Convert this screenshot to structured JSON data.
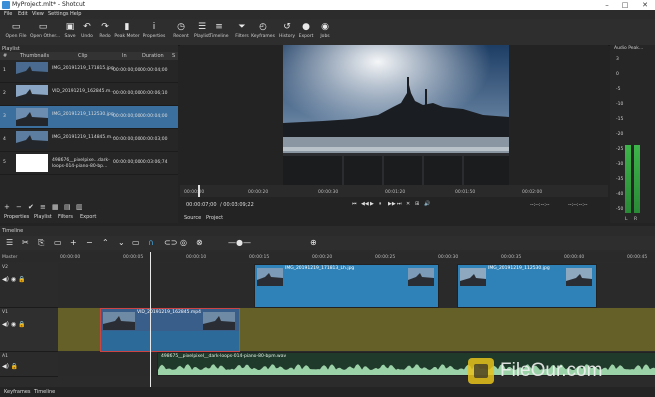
{
  "window": {
    "title": "MyProject.mlt* - Shotcut",
    "controls": [
      "–",
      "□",
      "✕"
    ]
  },
  "menu": [
    "File",
    "Edit",
    "View",
    "Settings",
    "Help"
  ],
  "toolbar": [
    {
      "icon": "folder-open-icon",
      "glyph": "▭",
      "label": "Open File"
    },
    {
      "icon": "open-other-icon",
      "glyph": "▭",
      "label": "Open Other..."
    },
    {
      "icon": "save-icon",
      "glyph": "▣",
      "label": "Save"
    },
    {
      "icon": "undo-icon",
      "glyph": "↶",
      "label": "Undo"
    },
    {
      "icon": "redo-icon",
      "glyph": "↷",
      "label": "Redo"
    },
    {
      "icon": "peak-meter-icon",
      "glyph": "▮",
      "label": "Peak Meter"
    },
    {
      "icon": "properties-icon",
      "glyph": "ⅰ",
      "label": "Properties"
    },
    {
      "icon": "recent-icon",
      "glyph": "◷",
      "label": "Recent"
    },
    {
      "icon": "playlist-icon",
      "glyph": "☰",
      "label": "Playlist"
    },
    {
      "icon": "timeline-icon",
      "glyph": "≡",
      "label": "Timeline"
    },
    {
      "icon": "filters-icon",
      "glyph": "⏷",
      "label": "Filters"
    },
    {
      "icon": "keyframes-icon",
      "glyph": "◴",
      "label": "Keyframes"
    },
    {
      "icon": "history-icon",
      "glyph": "↺",
      "label": "History"
    },
    {
      "icon": "export-icon",
      "glyph": "●",
      "label": "Export"
    },
    {
      "icon": "jobs-icon",
      "glyph": "◉",
      "label": "Jobs"
    }
  ],
  "playlist": {
    "title": "Playlist",
    "columns": [
      "#",
      "Thumbnails",
      "Clip",
      "In",
      "Duration",
      "S"
    ],
    "rows": [
      {
        "num": "1",
        "clip": "IMG_20191219_171815.jpg",
        "in": "00:00:00;00",
        "duration": "00:00:04;00",
        "selected": false
      },
      {
        "num": "2",
        "clip": "VID_20191219_162845.m...",
        "in": "00:00:00;00",
        "duration": "00:00:06;10",
        "selected": false
      },
      {
        "num": "3",
        "clip": "IMG_20191219_112530.jpg",
        "in": "00:00:00;00",
        "duration": "00:00:04;00",
        "selected": true
      },
      {
        "num": "4",
        "clip": "IMG_20191219_114845.m...",
        "in": "00:00:00;00",
        "duration": "00:00:03;00",
        "selected": false
      },
      {
        "num": "5",
        "clip": "498676__pixelpixe...dark-loops-014-piano-80-bp...",
        "in": "00:00:00;00",
        "duration": "00:03:06;74",
        "selected": false
      }
    ],
    "tools": [
      "+",
      "−",
      "✔",
      "≡",
      "▦",
      "▤",
      "▥"
    ],
    "tabs": [
      "Properties",
      "Playlist",
      "Filters",
      "Export"
    ]
  },
  "viewer": {
    "ruler_ticks": [
      "00:00:00",
      "00:00:20",
      "00:00:30",
      "00:01:20",
      "00:01:50",
      "00:02:00"
    ],
    "timecode_current": "00:00:07;00",
    "timecode_total": "/ 00:03:09;22",
    "transport": [
      "⏮",
      "◀◀",
      "▶",
      "⏸",
      "▶▶",
      "⏭",
      "✕",
      "⊞",
      "🔊"
    ],
    "in_out": "--:--:--:--",
    "tabs": [
      "Source",
      "Project"
    ]
  },
  "meter": {
    "title": "Audio Peak...",
    "scale": [
      "3",
      "0",
      "-5",
      "-10",
      "-15",
      "-20",
      "-25",
      "-30",
      "-35",
      "-40",
      "-50"
    ],
    "channels": [
      "L",
      "R"
    ],
    "level_left": 0.45,
    "level_right": 0.45
  },
  "timeline": {
    "title": "Timeline",
    "ruler_ticks": [
      "00:00:00",
      "00:00:05",
      "00:00:10",
      "00:00:15",
      "00:00:20",
      "00:00:25",
      "00:00:30",
      "00:00:35",
      "00:00:40",
      "00:00:45"
    ],
    "master_label": "Master",
    "tracks": [
      {
        "name": "V2"
      },
      {
        "name": "V1"
      },
      {
        "name": "A1"
      }
    ],
    "clips": {
      "v2a": "IMG_20191219_171813_Lh.jpg",
      "v2b": "IMG_20191219_112530.jpg",
      "v1": "VID_20191219_162845.mp4",
      "a1": "498675__pixelpixel__dark-loops-014-piano-80-bpm.wav"
    },
    "tool_glyphs": [
      "☰",
      "✂",
      "⎘",
      "▭",
      "+",
      "−",
      "⌃",
      "⌄",
      "▭",
      "∩",
      "⊂⊃",
      "◎",
      "⊗",
      "—●—",
      "⊕"
    ]
  },
  "bottom_tabs": [
    "Keyframes",
    "Timeline"
  ],
  "watermark": "FileOur.com",
  "colors": {
    "selection": "#3b6f9e",
    "clip_blue": "#2e82b7",
    "video_track": "#646027",
    "audio_wave": "#9bd2a8",
    "meter_green": "#3db54a"
  }
}
